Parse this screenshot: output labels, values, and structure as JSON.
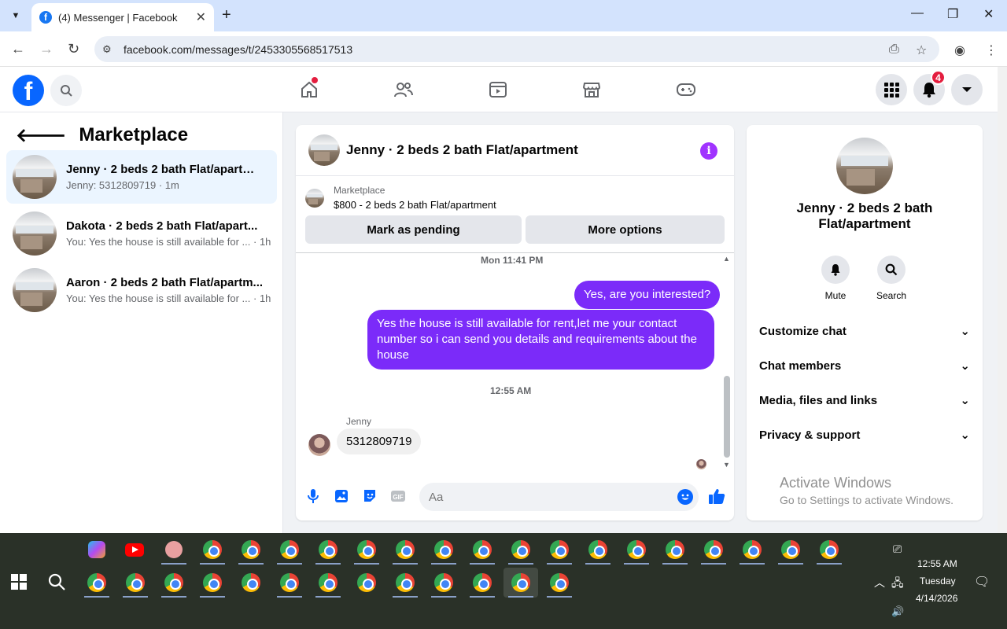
{
  "browser": {
    "tab_title": "(4) Messenger | Facebook",
    "url": "facebook.com/messages/t/2453305568517513"
  },
  "header": {
    "notification_count": "4",
    "icons": [
      "home-icon",
      "friends-icon",
      "video-icon",
      "marketplace-icon",
      "gaming-icon",
      "menu-grid-icon",
      "bell-icon",
      "account-caret-icon"
    ]
  },
  "sidebar": {
    "title": "Marketplace",
    "conversations": [
      {
        "name": "Jenny · 2 beds 2 bath Flat/apartme...",
        "preview": "Jenny: 5312809719 · 1m"
      },
      {
        "name": "Dakota · 2 beds 2 bath Flat/apart...",
        "preview": "You: Yes the house is still available for ... · 1h"
      },
      {
        "name": "Aaron · 2 beds 2 bath Flat/apartm...",
        "preview": "You: Yes the house is still available for ... · 1h"
      }
    ]
  },
  "chat": {
    "title": "Jenny · 2 beds 2 bath Flat/apartment",
    "marketplace_label": "Marketplace",
    "listing": "$800 - 2 beds 2 bath Flat/apartment",
    "mark_pending": "Mark as pending",
    "more_options": "More options",
    "timestamp1": "Mon 11:41 PM",
    "msg1": "Yes, are you interested?",
    "msg2": "Yes the house is still available for rent,let me your contact number so i can send you details and requirements about the house",
    "timestamp2": "12:55 AM",
    "sender": "Jenny",
    "msg3": "5312809719",
    "input_placeholder": "Aa"
  },
  "info_panel": {
    "name": "Jenny · 2 beds 2 bath Flat/apartment",
    "mute": "Mute",
    "search": "Search",
    "items": [
      "Customize chat",
      "Chat members",
      "Media, files and links",
      "Privacy & support"
    ]
  },
  "watermark": {
    "line1": "Activate Windows",
    "line2": "Go to Settings to activate Windows."
  },
  "taskbar": {
    "time": "12:55 AM",
    "day": "Tuesday",
    "date": "4/14/2026"
  },
  "colors": {
    "fb_blue": "#0866ff",
    "bubble_purple": "#7b2bf9",
    "info_purple": "#a033ff",
    "badge_red": "#e41e3f"
  }
}
